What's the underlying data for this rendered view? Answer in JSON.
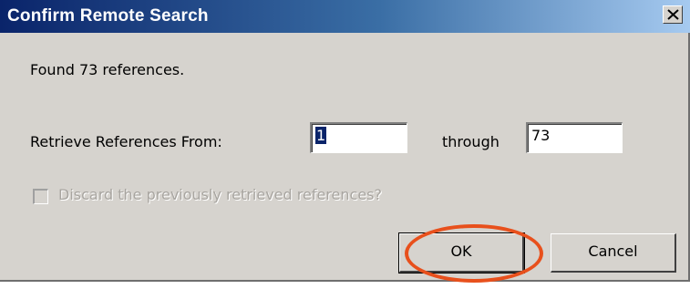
{
  "window": {
    "title": "Confirm Remote Search",
    "close_glyph": "close-icon"
  },
  "message": {
    "found_text": "Found 73 references."
  },
  "range": {
    "label": "Retrieve References From:",
    "from_value": "1",
    "through_label": "through",
    "to_value": "73"
  },
  "options": {
    "discard_label": "Discard the previously retrieved references?",
    "discard_checked": false,
    "discard_enabled": false
  },
  "buttons": {
    "ok_label": "OK",
    "cancel_label": "Cancel"
  },
  "colors": {
    "titlebar_start": "#0a246a",
    "titlebar_end": "#a6caf0",
    "dialog_bg": "#d6d3ce",
    "annotation_ring": "#e8501c"
  }
}
